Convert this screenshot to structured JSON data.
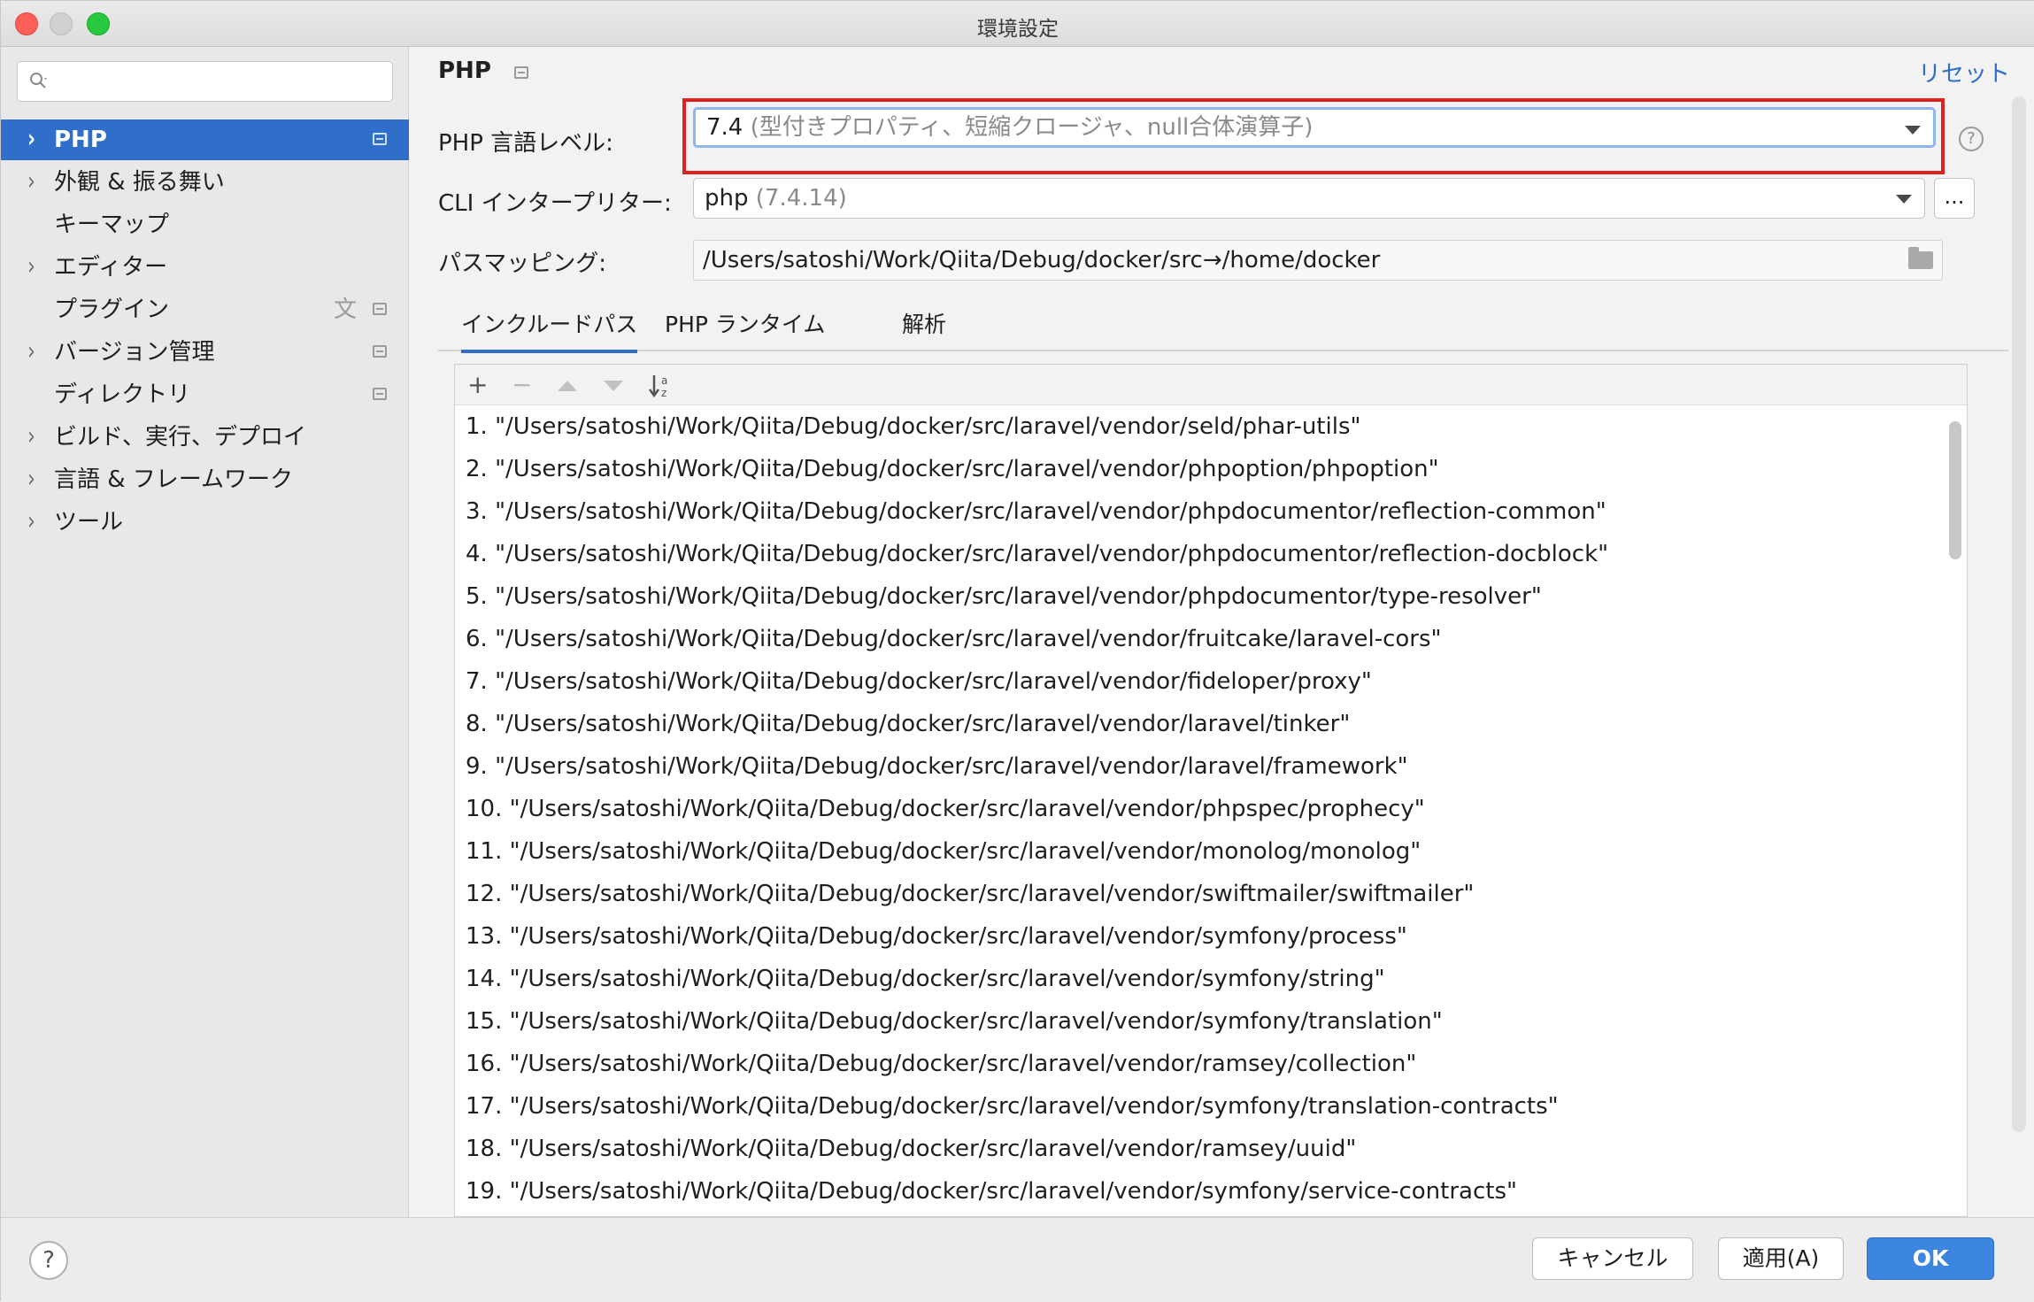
{
  "window": {
    "title": "環境設定"
  },
  "sidebar": {
    "items": [
      {
        "label": "PHP",
        "chevron": true,
        "page_icon": true,
        "selected": true
      },
      {
        "label": "外観 & 振る舞い",
        "chevron": true
      },
      {
        "label": "キーマップ",
        "chevron": false
      },
      {
        "label": "エディター",
        "chevron": true
      },
      {
        "label": "プラグイン",
        "chevron": false,
        "page_icon": true,
        "translate_icon": true
      },
      {
        "label": "バージョン管理",
        "chevron": true,
        "page_icon": true
      },
      {
        "label": "ディレクトリ",
        "chevron": false,
        "page_icon": true
      },
      {
        "label": "ビルド、実行、デプロイ",
        "chevron": true
      },
      {
        "label": "言語 & フレームワーク",
        "chevron": true
      },
      {
        "label": "ツール",
        "chevron": true
      }
    ]
  },
  "main": {
    "title": "PHP",
    "reset_label": "リセット",
    "language_level": {
      "label": "PHP 言語レベル:",
      "value": "7.4",
      "hint": "(型付きプロパティ、短縮クロージャ、null合体演算子)"
    },
    "cli": {
      "label": "CLI インタープリター:",
      "value": "php",
      "hint": "(7.4.14)",
      "button_label": "..."
    },
    "path_mapping": {
      "label": "パスマッピング:",
      "value": "/Users/satoshi/Work/Qiita/Debug/docker/src→/home/docker"
    },
    "tabs": [
      {
        "label": "インクルードパス",
        "active": true
      },
      {
        "label": "PHP ランタイム",
        "active": false
      },
      {
        "label": "解析",
        "active": false
      }
    ],
    "include_paths": [
      "1. \"/Users/satoshi/Work/Qiita/Debug/docker/src/laravel/vendor/seld/phar-utils\"",
      "2. \"/Users/satoshi/Work/Qiita/Debug/docker/src/laravel/vendor/phpoption/phpoption\"",
      "3. \"/Users/satoshi/Work/Qiita/Debug/docker/src/laravel/vendor/phpdocumentor/reflection-common\"",
      "4. \"/Users/satoshi/Work/Qiita/Debug/docker/src/laravel/vendor/phpdocumentor/reflection-docblock\"",
      "5. \"/Users/satoshi/Work/Qiita/Debug/docker/src/laravel/vendor/phpdocumentor/type-resolver\"",
      "6. \"/Users/satoshi/Work/Qiita/Debug/docker/src/laravel/vendor/fruitcake/laravel-cors\"",
      "7. \"/Users/satoshi/Work/Qiita/Debug/docker/src/laravel/vendor/fideloper/proxy\"",
      "8. \"/Users/satoshi/Work/Qiita/Debug/docker/src/laravel/vendor/laravel/tinker\"",
      "9. \"/Users/satoshi/Work/Qiita/Debug/docker/src/laravel/vendor/laravel/framework\"",
      "10. \"/Users/satoshi/Work/Qiita/Debug/docker/src/laravel/vendor/phpspec/prophecy\"",
      "11. \"/Users/satoshi/Work/Qiita/Debug/docker/src/laravel/vendor/monolog/monolog\"",
      "12. \"/Users/satoshi/Work/Qiita/Debug/docker/src/laravel/vendor/swiftmailer/swiftmailer\"",
      "13. \"/Users/satoshi/Work/Qiita/Debug/docker/src/laravel/vendor/symfony/process\"",
      "14. \"/Users/satoshi/Work/Qiita/Debug/docker/src/laravel/vendor/symfony/string\"",
      "15. \"/Users/satoshi/Work/Qiita/Debug/docker/src/laravel/vendor/symfony/translation\"",
      "16. \"/Users/satoshi/Work/Qiita/Debug/docker/src/laravel/vendor/ramsey/collection\"",
      "17. \"/Users/satoshi/Work/Qiita/Debug/docker/src/laravel/vendor/symfony/translation-contracts\"",
      "18. \"/Users/satoshi/Work/Qiita/Debug/docker/src/laravel/vendor/ramsey/uuid\"",
      "19. \"/Users/satoshi/Work/Qiita/Debug/docker/src/laravel/vendor/symfony/service-contracts\""
    ]
  },
  "footer": {
    "help_label": "?",
    "cancel_label": "キャンセル",
    "apply_label": "適用(A)",
    "ok_label": "OK"
  },
  "colors": {
    "accent": "#2f6fc9",
    "highlight_border": "#e0201e",
    "primary_button": "#3d86e0"
  },
  "icons": {
    "search": "search-icon",
    "add": "plus-icon",
    "remove": "minus-icon",
    "up": "arrow-up-icon",
    "down": "arrow-down-icon",
    "sort": "sort-az-icon",
    "folder": "folder-icon",
    "help": "help-icon"
  }
}
